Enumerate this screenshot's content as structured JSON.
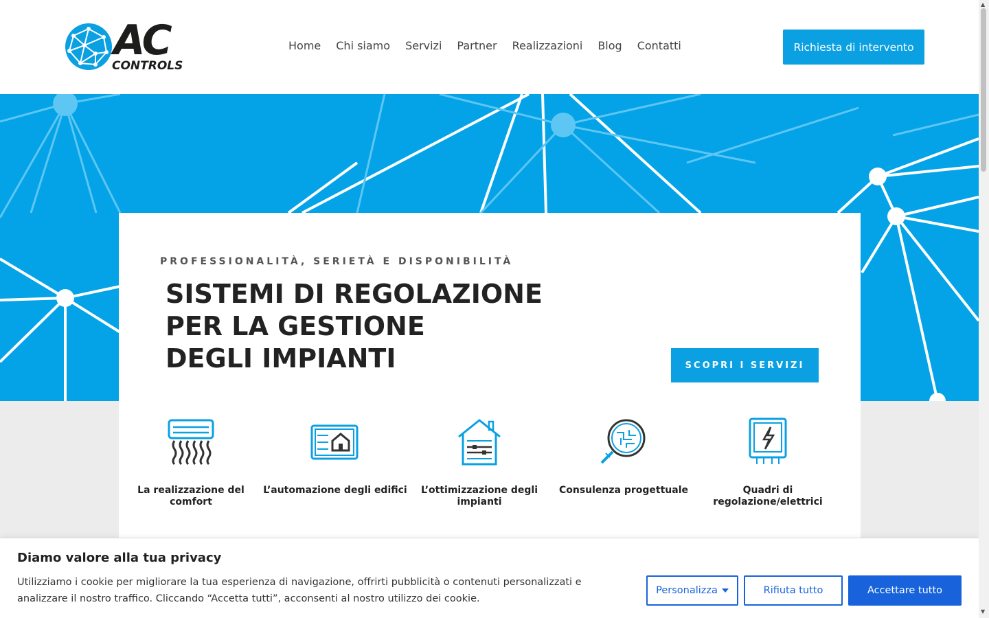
{
  "brand": {
    "name_main": "AC",
    "name_sub": "CONTROLS"
  },
  "nav": {
    "items": [
      {
        "label": "Home"
      },
      {
        "label": "Chi siamo"
      },
      {
        "label": "Servizi"
      },
      {
        "label": "Partner"
      },
      {
        "label": "Realizzazioni"
      },
      {
        "label": "Blog"
      },
      {
        "label": "Contatti"
      }
    ],
    "cta_label": "Richiesta di intervento"
  },
  "hero": {
    "eyebrow": "PROFESSIONALITÀ, SERIETÀ E DISPONIBILITÀ",
    "headline": [
      "SISTEMI DI REGOLAZIONE",
      "PER LA GESTIONE",
      "DEGLI IMPIANTI"
    ],
    "cta_label": "SCOPRI I SERVIZI"
  },
  "features": [
    {
      "icon": "air-conditioner-icon",
      "label": "La realizzazione del comfort"
    },
    {
      "icon": "smart-home-panel-icon",
      "label": "L’automazione degli edifici"
    },
    {
      "icon": "house-sliders-icon",
      "label": "L’ottimizzazione degli impianti"
    },
    {
      "icon": "magnifier-circuit-icon",
      "label": "Consulenza progettuale"
    },
    {
      "icon": "electrical-panel-icon",
      "label": "Quadri di regolazione/elettrici"
    }
  ],
  "cookie": {
    "title": "Diamo valore alla tua privacy",
    "text": "Utilizziamo i cookie per migliorare la tua esperienza di navigazione, offrirti pubblicità o contenuti personalizzati e analizzare il nostro traffico. Cliccando “Accetta tutti”, acconsenti al nostro utilizzo dei cookie.",
    "customize_label": "Personalizza",
    "reject_label": "Rifiuta tutto",
    "accept_label": "Accettare tutto"
  },
  "colors": {
    "brand_blue": "#04a3e8",
    "button_blue": "#0aa0e2",
    "cookie_blue": "#1863dc"
  }
}
